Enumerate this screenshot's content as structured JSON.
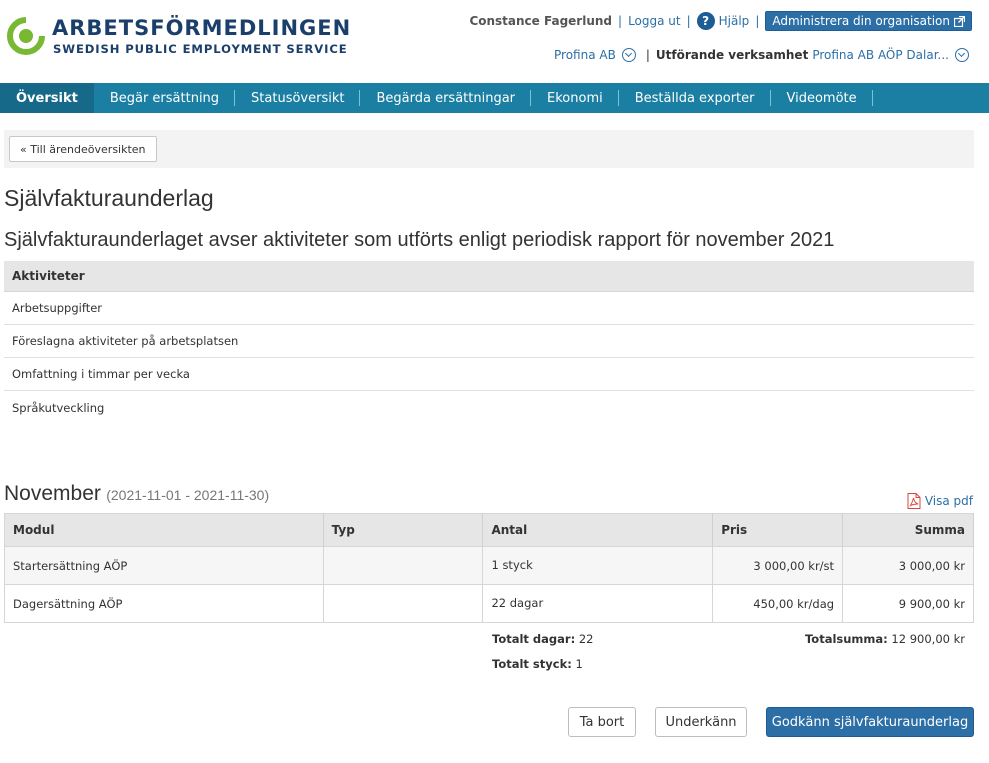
{
  "header": {
    "logo_name": "ARBETSFÖRMEDLINGEN",
    "logo_sub": "SWEDISH PUBLIC EMPLOYMENT SERVICE",
    "user_name": "Constance Fagerlund",
    "logout": "Logga ut",
    "help": "Hjälp",
    "admin": "Administrera din organisation",
    "org": "Profina AB",
    "exec_label": "Utförande verksamhet",
    "exec_value": "Profina AB AÖP Dalar..."
  },
  "nav": {
    "items": [
      "Översikt",
      "Begär ersättning",
      "Statusöversikt",
      "Begärda ersättningar",
      "Ekonomi",
      "Beställda exporter",
      "Videomöte"
    ]
  },
  "back_button": "« Till ärendeöversikten",
  "page_title": "Självfakturaunderlag",
  "subtitle": "Självfakturaunderlaget avser aktiviteter som utförts enligt periodisk rapport för november 2021",
  "activities": {
    "header": "Aktiviteter",
    "rows": [
      "Arbetsuppgifter",
      "Föreslagna aktiviteter på arbetsplatsen",
      "Omfattning i timmar per vecka",
      "Språkutveckling"
    ]
  },
  "period": {
    "month": "November",
    "range": "(2021-11-01 - 2021-11-30)",
    "pdf": "Visa pdf"
  },
  "modules": {
    "columns": [
      "Modul",
      "Typ",
      "Antal",
      "Pris",
      "Summa"
    ],
    "rows": [
      {
        "modul": "Startersättning AÖP",
        "typ": "",
        "antal": "1 styck",
        "pris": "3 000,00 kr/st",
        "summa": "3 000,00 kr"
      },
      {
        "modul": "Dagersättning AÖP",
        "typ": "",
        "antal": "22 dagar",
        "pris": "450,00 kr/dag",
        "summa": "9 900,00 kr"
      }
    ]
  },
  "totals": {
    "days_label": "Totalt dagar:",
    "days_value": "22",
    "pieces_label": "Totalt styck:",
    "pieces_value": "1",
    "sum_label": "Totalsumma:",
    "sum_value": "12 900,00 kr"
  },
  "actions": {
    "delete": "Ta bort",
    "reject": "Underkänn",
    "approve": "Godkänn självfakturaunderlag"
  },
  "colors": {
    "nav_bg": "#1b7fa3",
    "brand_blue": "#1b3f6b",
    "brand_green": "#78b833",
    "link": "#2c6fa6",
    "primary": "#2c6fa6"
  }
}
